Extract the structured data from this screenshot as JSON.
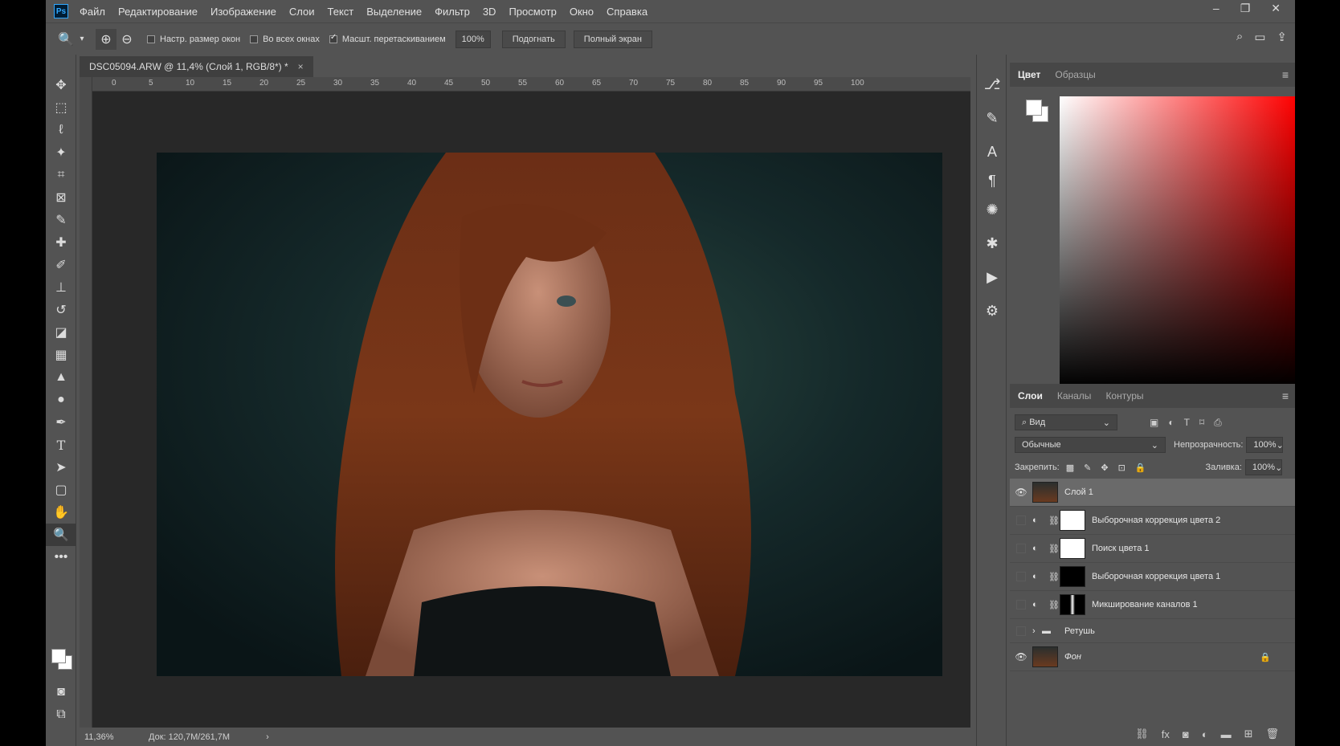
{
  "app": {
    "logo": "Ps"
  },
  "menu": [
    "Файл",
    "Редактирование",
    "Изображение",
    "Слои",
    "Текст",
    "Выделение",
    "Фильтр",
    "3D",
    "Просмотр",
    "Окно",
    "Справка"
  ],
  "window_controls": {
    "minimize": "–",
    "restore": "❐",
    "close": "✕"
  },
  "options": {
    "resize_windows": "Настр. размер окон",
    "all_windows": "Во всех окнах",
    "scrubby_zoom": "Масшт. перетаскиванием",
    "zoom_value": "100%",
    "fit_label": "Подогнать",
    "fullscreen_label": "Полный экран"
  },
  "document": {
    "tab_title": "DSC05094.ARW @ 11,4% (Слой 1, RGB/8*) *",
    "close": "×",
    "ruler_ticks": [
      "0",
      "5",
      "10",
      "15",
      "20",
      "25",
      "30",
      "35",
      "40",
      "45",
      "50",
      "55",
      "60",
      "65",
      "70",
      "75",
      "80",
      "85",
      "90",
      "95",
      "100"
    ]
  },
  "status": {
    "zoom": "11,36%",
    "doc_size": "Док: 120,7M/261,7M",
    "arrow": "›"
  },
  "color_panel": {
    "tab_color": "Цвет",
    "tab_swatches": "Образцы"
  },
  "layers_panel": {
    "tab_layers": "Слои",
    "tab_channels": "Каналы",
    "tab_paths": "Контуры",
    "filter_kind": "Вид",
    "blend_mode": "Обычные",
    "opacity_label": "Непрозрачность:",
    "opacity_value": "100%",
    "lock_label": "Закрепить:",
    "fill_label": "Заливка:",
    "fill_value": "100%",
    "layers": [
      {
        "name": "Слой 1",
        "visible": true
      },
      {
        "name": "Выборочная коррекция цвета 2",
        "visible": false
      },
      {
        "name": "Поиск цвета 1",
        "visible": false
      },
      {
        "name": "Выборочная коррекция цвета 1",
        "visible": false
      },
      {
        "name": "Микширование каналов 1",
        "visible": false
      },
      {
        "name": "Ретушь",
        "visible": false
      },
      {
        "name": "Фон",
        "visible": true
      }
    ]
  },
  "colors": {
    "ui_bg": "#535353",
    "canvas_bg": "#282828",
    "ps_blue": "#31a8ff"
  }
}
